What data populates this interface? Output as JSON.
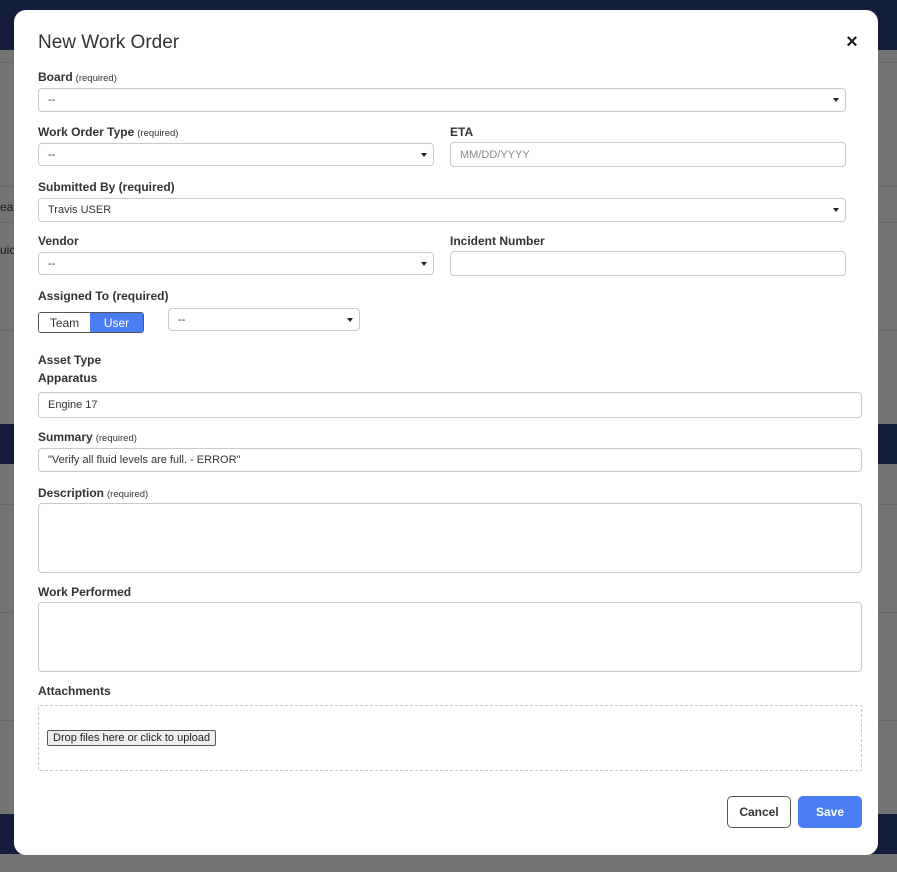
{
  "background": {
    "partial_texts": [
      "eat",
      "uic"
    ]
  },
  "modal": {
    "title": "New Work Order",
    "close_icon": "×"
  },
  "form": {
    "board": {
      "label": "Board",
      "req": "(required)",
      "value": "--"
    },
    "work_order_type": {
      "label": "Work Order Type",
      "req": "(required)",
      "value": "--"
    },
    "eta": {
      "label": "ETA",
      "placeholder": "MM/DD/YYYY",
      "value": ""
    },
    "submitted_by": {
      "label": "Submitted By (required)",
      "value": "Travis USER"
    },
    "vendor": {
      "label": "Vendor",
      "value": "--"
    },
    "incident_number": {
      "label": "Incident Number",
      "value": ""
    },
    "assigned_to": {
      "label": "Assigned To (required)",
      "options": [
        "Team",
        "User"
      ],
      "selected": "User",
      "assignee_value": "--"
    },
    "asset_type": {
      "label": "Asset Type"
    },
    "apparatus": {
      "label": "Apparatus",
      "value": "Engine 17"
    },
    "summary": {
      "label": "Summary",
      "req": "(required)",
      "value": "\"Verify all fluid levels are full. - ERROR\""
    },
    "description": {
      "label": "Description",
      "req": "(required)",
      "value": ""
    },
    "work_performed": {
      "label": "Work Performed",
      "value": ""
    },
    "attachments": {
      "label": "Attachments",
      "upload_label": "Drop files here or click to upload"
    }
  },
  "actions": {
    "cancel": "Cancel",
    "save": "Save"
  },
  "colors": {
    "primary": "#4a7cf6",
    "header_bg": "#2b3a78"
  }
}
